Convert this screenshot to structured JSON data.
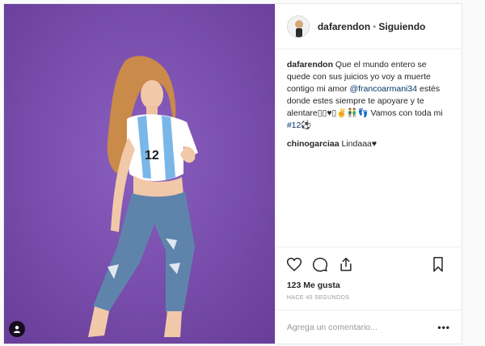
{
  "post": {
    "username": "dafarendon",
    "separator": "•",
    "follow_status": "Siguiendo",
    "caption_rest_1": " Que el mundo entero se quede con sus juicios yo voy a muerte contigo mi amor ",
    "mention": "@francoarmani34",
    "caption_rest_2": " estés donde estes siempre te apoyare y te alentare▯▯♥▯✌👬👣 Vamos con toda mi ",
    "hashtag": "#12⚽"
  },
  "comment": {
    "username": "chinogarciaa",
    "text": " Lindaaa♥"
  },
  "likes": "123 Me gusta",
  "timestamp": "HACE 40 SEGUNDOS",
  "input": {
    "placeholder": "Agrega un comentario..."
  },
  "more": "•••",
  "icons": {
    "like": "heart-icon",
    "comment": "comment-bubble-icon",
    "share": "share-icon",
    "save": "bookmark-icon",
    "tag": "user-tag-icon"
  },
  "colors": {
    "background": "#7b4fae",
    "link": "#003569",
    "muted": "#999999"
  }
}
